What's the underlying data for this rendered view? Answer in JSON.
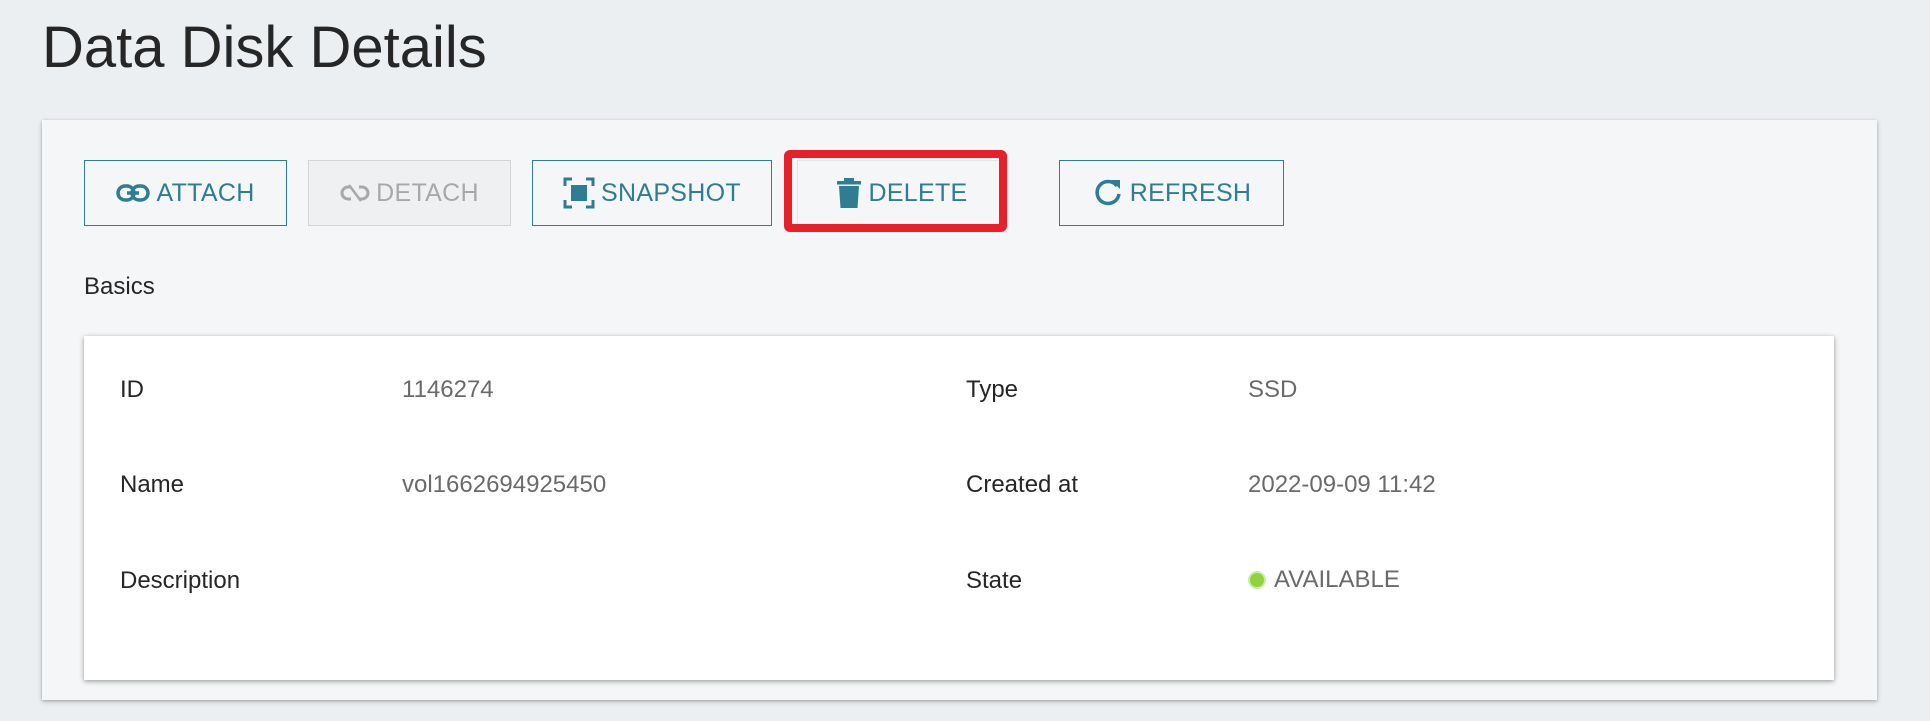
{
  "page": {
    "title": "Data Disk Details"
  },
  "toolbar": {
    "attach": {
      "label": "ATTACH",
      "icon": "link-icon"
    },
    "detach": {
      "label": "DETACH",
      "icon": "link-off-icon",
      "disabled": true
    },
    "snapshot": {
      "label": "SNAPSHOT",
      "icon": "snapshot-icon"
    },
    "delete": {
      "label": "DELETE",
      "icon": "trash-icon"
    },
    "refresh": {
      "label": "REFRESH",
      "icon": "refresh-icon"
    }
  },
  "basics": {
    "section_title": "Basics",
    "id_label": "ID",
    "id_value": "1146274",
    "name_label": "Name",
    "name_value": "vol1662694925450",
    "description_label": "Description",
    "description_value": "",
    "type_label": "Type",
    "type_value": "SSD",
    "created_label": "Created at",
    "created_value": "2022-09-09 11:42",
    "state_label": "State",
    "state_value": "AVAILABLE"
  },
  "colors": {
    "accent": "#2e7d93",
    "highlight": "#e8202a",
    "state_ok": "#8fd43c"
  }
}
